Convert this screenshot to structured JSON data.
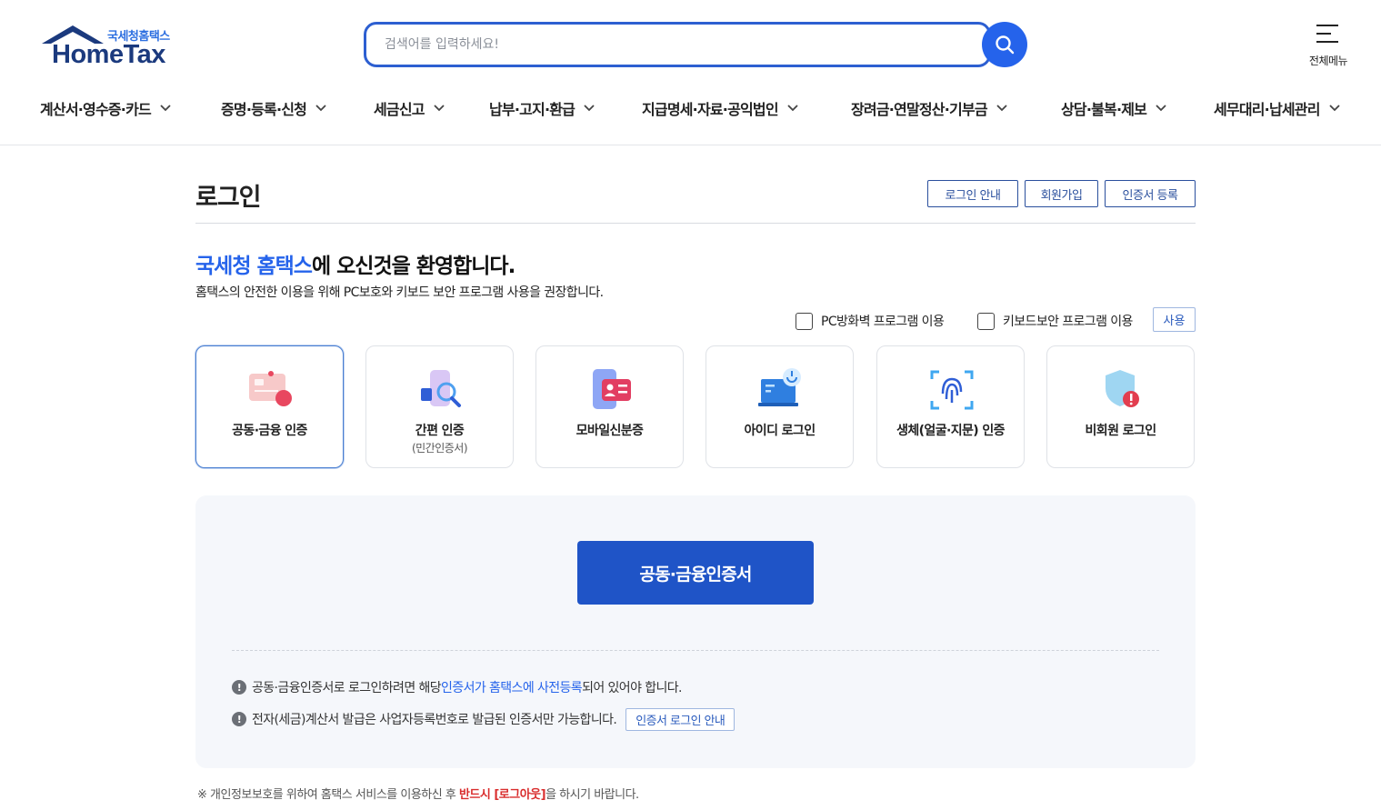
{
  "header": {
    "logo_kor": "국세청홈택스",
    "logo_eng": "HomeTax",
    "search_placeholder": "검색어를 입력하세요!",
    "all_menu_label": "전체메뉴",
    "nav": [
      {
        "label": "계산서·영수증·카드"
      },
      {
        "label": "증명·등록·신청"
      },
      {
        "label": "세금신고"
      },
      {
        "label": "납부·고지·환급"
      },
      {
        "label": "지급명세·자료·공익법인"
      },
      {
        "label": "장려금·연말정산·기부금"
      },
      {
        "label": "상담·불복·제보"
      },
      {
        "label": "세무대리·납세관리"
      }
    ]
  },
  "main": {
    "title": "로그인",
    "top_buttons": [
      "로그인 안내",
      "회원가입",
      "인증서 등록"
    ],
    "welcome_highlight": "국세청 홈택스",
    "welcome_rest": "에 오신것을 환영합니다.",
    "welcome_sub": "홈택스의 안전한 이용을 위해 PC보호와 키보드 보안 프로그램 사용을 권장합니다.",
    "options": [
      {
        "label": "PC방화벽 프로그램 이용",
        "checked": false
      },
      {
        "label": "키보드보안 프로그램 이용",
        "checked": false
      }
    ],
    "use_button": "사용",
    "login_methods": [
      {
        "label": "공동·금융 인증",
        "sub": "",
        "icon": "certificate-card-icon",
        "active": true
      },
      {
        "label": "간편 인증",
        "sub": "(민간인증서)",
        "icon": "simple-auth-icon",
        "active": false
      },
      {
        "label": "모바일신분증",
        "sub": "",
        "icon": "mobile-id-icon",
        "active": false
      },
      {
        "label": "아이디 로그인",
        "sub": "",
        "icon": "id-login-icon",
        "active": false
      },
      {
        "label": "생체(얼굴·지문) 인증",
        "sub": "",
        "icon": "fingerprint-icon",
        "active": false
      },
      {
        "label": "비회원 로그인",
        "sub": "",
        "icon": "shield-icon",
        "active": false
      }
    ],
    "main_button": "공동·금융인증서",
    "notes": {
      "note1_pre": "공동·금융인증서로 로그인하려면 해당 ",
      "note1_link": "인증서가 홈택스에 사전등록",
      "note1_post": "되어 있어야 합니다.",
      "note2": "전자(세금)계산서 발급은 사업자등록번호로 발급된 인증서만 가능합니다.",
      "note2_button": "인증서 로그인 안내"
    },
    "footer_pre": "※ 개인정보보호를 위하여 홈택스 서비스를 이용하신 후 ",
    "footer_red": "반드시 [로그아웃]",
    "footer_post": "을 하시기 바랍니다."
  },
  "colors": {
    "brand_blue": "#2563eb",
    "primary_button": "#1f54c7",
    "navy": "#1b3a7e",
    "warning_red": "#d92d2d"
  }
}
